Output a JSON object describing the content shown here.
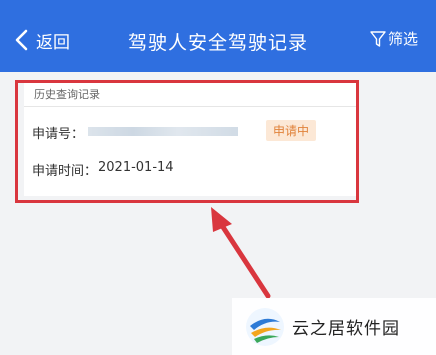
{
  "navbar": {
    "back_label": "返回",
    "title": "驾驶人安全驾驶记录",
    "filter_label": "筛选",
    "background": "#2f6fe0"
  },
  "record_card": {
    "section_title": "历史查询记录",
    "application_number_label": "申请号：",
    "status_badge": "申请中",
    "application_time_label": "申请时间：",
    "application_time_value": "2021-01-14"
  },
  "annotation": {
    "highlight_color": "#d9363e"
  },
  "watermark": {
    "text": "云之居软件园"
  }
}
